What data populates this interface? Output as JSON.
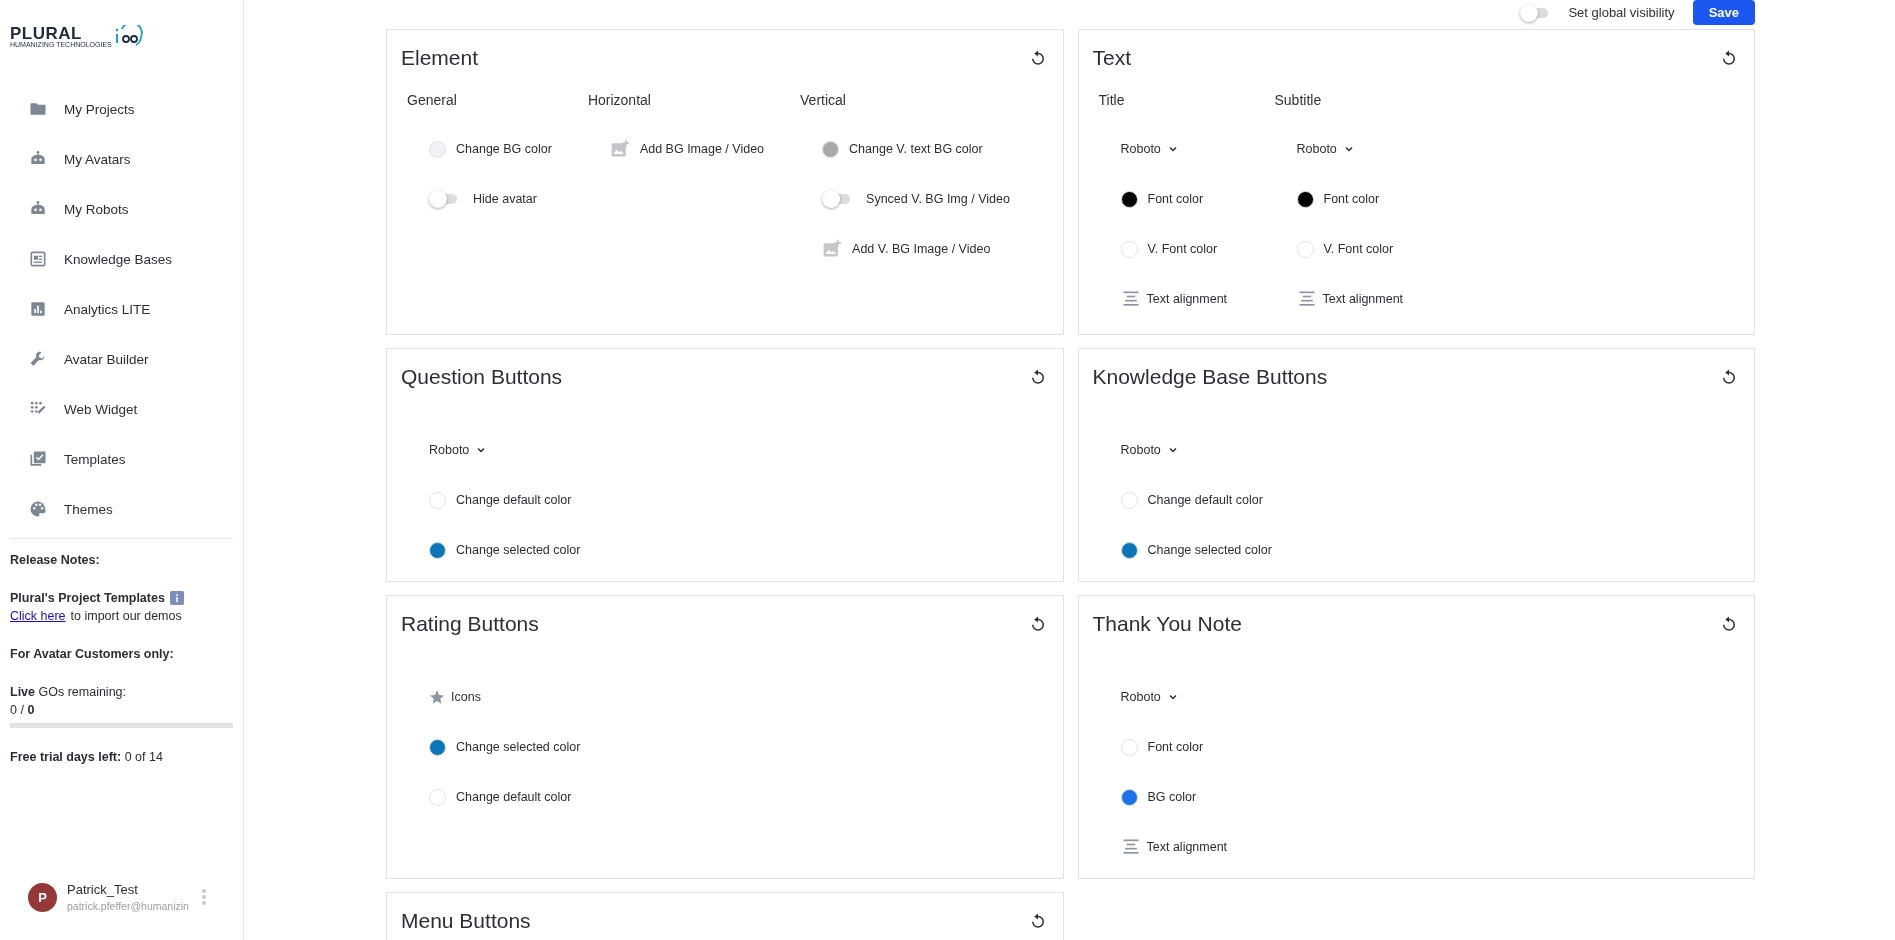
{
  "logo": {
    "name": "PLURAL",
    "tagline": "HUMANIZING TECHNOLOGIES"
  },
  "nav": [
    {
      "label": "My Projects"
    },
    {
      "label": "My Avatars"
    },
    {
      "label": "My Robots"
    },
    {
      "label": "Knowledge Bases"
    },
    {
      "label": "Analytics LITE"
    },
    {
      "label": "Avatar Builder"
    },
    {
      "label": "Web Widget"
    },
    {
      "label": "Templates"
    },
    {
      "label": "Themes"
    }
  ],
  "release_notes": {
    "heading": "Release Notes:",
    "templates_title": "Plural's Project Templates",
    "link": "Click here",
    "link_suffix": "to import our demos",
    "customers_heading": "For Avatar Customers only:",
    "gos_label": "**Live** GOs remaining:",
    "gos_value": "0 / **0**",
    "gos_bar": {
      "level": 0
    },
    "trial": "**Free trial days left:** 0 of 14"
  },
  "user": {
    "initial": "P",
    "name": "Patrick_Test",
    "email": "patrick.pfeffer@humanizin"
  },
  "toolbar": {
    "global_visibility": {
      "label": "Set global visibility",
      "on": false
    },
    "save": "Save"
  },
  "cards": [
    {
      "title": "Element",
      "columns": [
        {
          "heading": "General",
          "items": [
            {
              "kind": "color",
              "label": "Change BG color",
              "color": "#f1f1f5"
            },
            {
              "kind": "toggle",
              "label": "Hide avatar",
              "on": false
            }
          ]
        },
        {
          "heading": "Horizontal",
          "items": [
            {
              "kind": "image",
              "label": "Add BG Image / Video"
            }
          ]
        },
        {
          "heading": "Vertical",
          "items": [
            {
              "kind": "color",
              "label": "Change V. text BG color",
              "color": "#a9a9ab"
            },
            {
              "kind": "toggle",
              "label": "Synced V. BG Img / Video",
              "on": false
            },
            {
              "kind": "image",
              "label": "Add V. BG Image / Video"
            }
          ]
        }
      ]
    },
    {
      "title": "Text",
      "columns": [
        {
          "heading": "Title",
          "items": [
            {
              "kind": "font",
              "label": "Roboto"
            },
            {
              "kind": "color",
              "label": "Font color",
              "color": "#000000"
            },
            {
              "kind": "color",
              "label": "V. Font color",
              "color": "#ffffff"
            },
            {
              "kind": "align",
              "label": "Text alignment"
            }
          ]
        },
        {
          "heading": "Subtitle",
          "items": [
            {
              "kind": "font",
              "label": "Roboto"
            },
            {
              "kind": "color",
              "label": "Font color",
              "color": "#000000"
            },
            {
              "kind": "color",
              "label": "V. Font color",
              "color": "#ffffff"
            },
            {
              "kind": "align",
              "label": "Text alignment"
            }
          ]
        }
      ]
    },
    {
      "title": "Question Buttons",
      "columns": [
        {
          "items": [
            {
              "kind": "font",
              "label": "Roboto"
            },
            {
              "kind": "color",
              "label": "Change default color",
              "color": "#ffffff"
            },
            {
              "kind": "color",
              "label": "Change selected color",
              "color": "#0a78b8"
            }
          ]
        }
      ]
    },
    {
      "title": "Knowledge Base Buttons",
      "columns": [
        {
          "items": [
            {
              "kind": "font",
              "label": "Roboto"
            },
            {
              "kind": "color",
              "label": "Change default color",
              "color": "#ffffff"
            },
            {
              "kind": "color",
              "label": "Change selected color",
              "color": "#0a78b8"
            }
          ]
        }
      ]
    },
    {
      "title": "Rating Buttons",
      "columns": [
        {
          "items": [
            {
              "kind": "icon",
              "label": "Icons"
            },
            {
              "kind": "color",
              "label": "Change selected color",
              "color": "#0a78b8"
            },
            {
              "kind": "color",
              "label": "Change default color",
              "color": "#ffffff"
            }
          ]
        }
      ]
    },
    {
      "title": "Thank You Note",
      "columns": [
        {
          "items": [
            {
              "kind": "font",
              "label": "Roboto"
            },
            {
              "kind": "color",
              "label": "Font color",
              "color": "#ffffff"
            },
            {
              "kind": "color",
              "label": "BG color",
              "color": "#1a73e8"
            },
            {
              "kind": "align",
              "label": "Text alignment"
            }
          ]
        }
      ]
    },
    {
      "title": "Menu Buttons"
    }
  ]
}
